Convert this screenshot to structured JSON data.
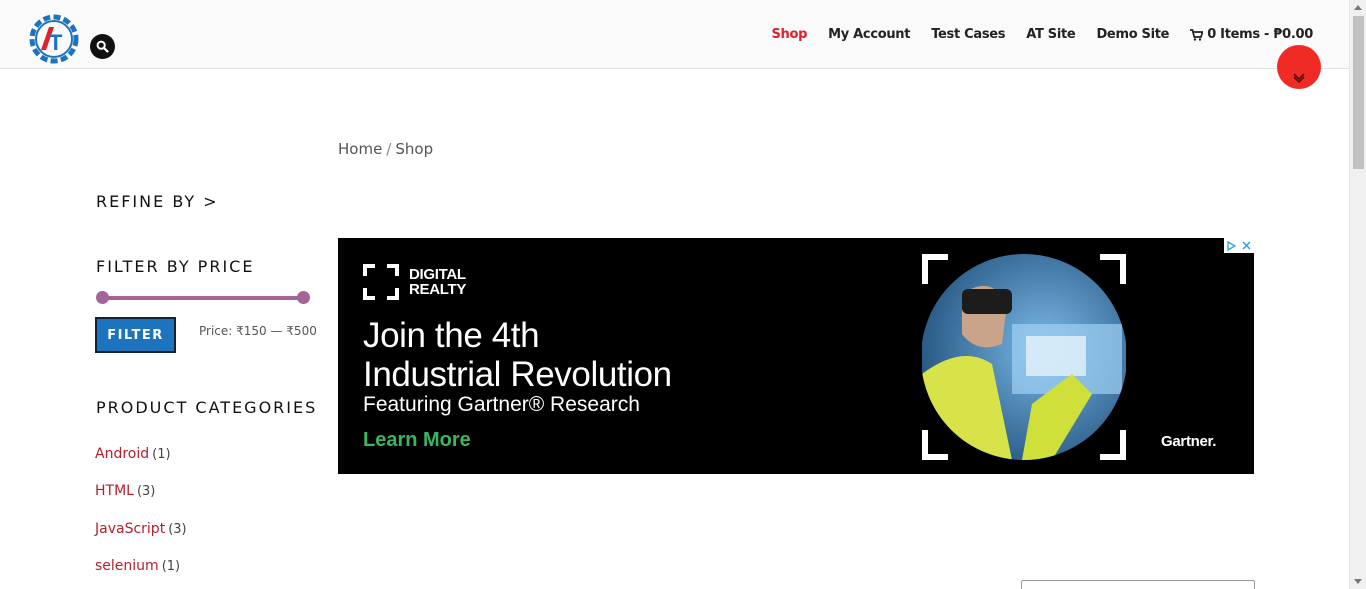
{
  "header": {
    "logo_letters": "AT",
    "nav": [
      {
        "label": "Shop",
        "active": true
      },
      {
        "label": "My Account"
      },
      {
        "label": "Test Cases"
      },
      {
        "label": "AT Site"
      },
      {
        "label": "Demo Site"
      }
    ],
    "cart_label": "0 Items - ₱0.00",
    "icons": [
      "logo-gear",
      "search-icon",
      "cart-icon",
      "chevron-down-icon"
    ]
  },
  "breadcrumb": {
    "home": "Home",
    "separator": "/",
    "current": "Shop"
  },
  "sidebar": {
    "refine_heading": "REFINE BY >",
    "filter_heading": "FILTER BY PRICE",
    "filter_button": "FILTER",
    "price_label": "Price: ₹150 — ₹500",
    "price_range": {
      "min": 150,
      "max": 500
    },
    "categories_heading": "PRODUCT CATEGORIES",
    "categories": [
      {
        "name": "Android",
        "count": "(1)"
      },
      {
        "name": "HTML",
        "count": "(3)"
      },
      {
        "name": "JavaScript",
        "count": "(3)"
      },
      {
        "name": "selenium",
        "count": "(1)"
      }
    ]
  },
  "ad": {
    "brand_line1": "DIGITAL",
    "brand_line2": "REALTY",
    "headline_line1": "Join the 4th",
    "headline_line2": "Industrial Revolution",
    "subline": "Featuring Gartner® Research",
    "cta": "Learn More",
    "partner": "Gartner."
  },
  "colors": {
    "accent_red": "#e0202a",
    "slider_purple": "#a46497",
    "filter_blue": "#1e73be",
    "cta_green": "#3bb55f"
  }
}
